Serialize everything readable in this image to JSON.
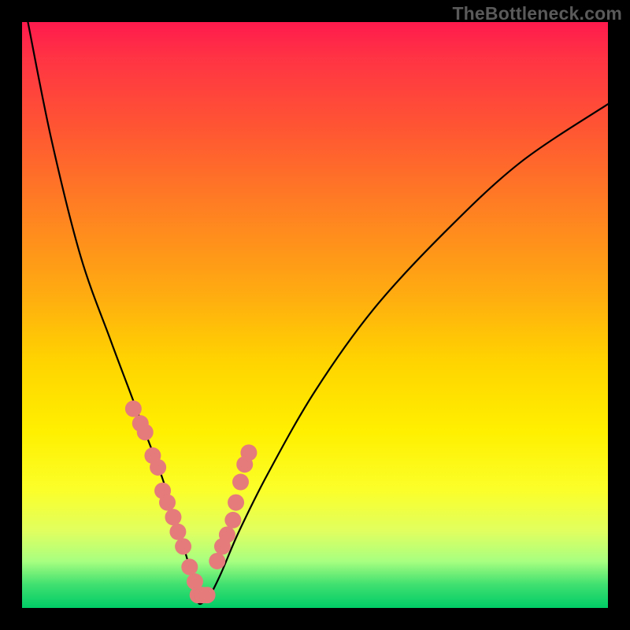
{
  "watermark": "TheBottleneck.com",
  "chart_data": {
    "type": "line",
    "title": "",
    "xlabel": "",
    "ylabel": "",
    "xlim": [
      0,
      100
    ],
    "ylim": [
      0,
      100
    ],
    "series": [
      {
        "name": "bottleneck-curve",
        "x": [
          1,
          5,
          10,
          15,
          18,
          21,
          24,
          26,
          28,
          29,
          30,
          31,
          32,
          34,
          37,
          42,
          50,
          60,
          72,
          85,
          100
        ],
        "values": [
          100,
          80,
          60,
          46,
          38,
          30,
          22,
          15,
          9,
          5,
          1,
          1,
          2,
          6,
          13,
          23,
          37,
          51,
          64,
          76,
          86
        ]
      }
    ],
    "highlight_points": {
      "name": "marked-configs",
      "x": [
        19.0,
        20.2,
        21.0,
        22.3,
        23.2,
        24.0,
        24.8,
        25.8,
        26.6,
        27.5,
        28.6,
        29.5,
        30.0,
        30.8,
        31.6,
        33.3,
        34.2,
        35.0,
        36.0,
        36.5,
        37.3,
        38.0,
        38.7
      ],
      "values": [
        34.0,
        31.5,
        30.0,
        26.0,
        24.0,
        20.0,
        18.0,
        15.5,
        13.0,
        10.5,
        7.0,
        4.5,
        2.2,
        2.2,
        2.2,
        8.0,
        10.5,
        12.5,
        15.0,
        18.0,
        21.5,
        24.5,
        26.5
      ]
    },
    "gradient_stops": [
      {
        "pct": 0,
        "color": "#ff1a4d"
      },
      {
        "pct": 18,
        "color": "#ff5533"
      },
      {
        "pct": 46,
        "color": "#ffaa11"
      },
      {
        "pct": 70,
        "color": "#fff000"
      },
      {
        "pct": 92,
        "color": "#a8ff80"
      },
      {
        "pct": 100,
        "color": "#00cc66"
      }
    ]
  }
}
